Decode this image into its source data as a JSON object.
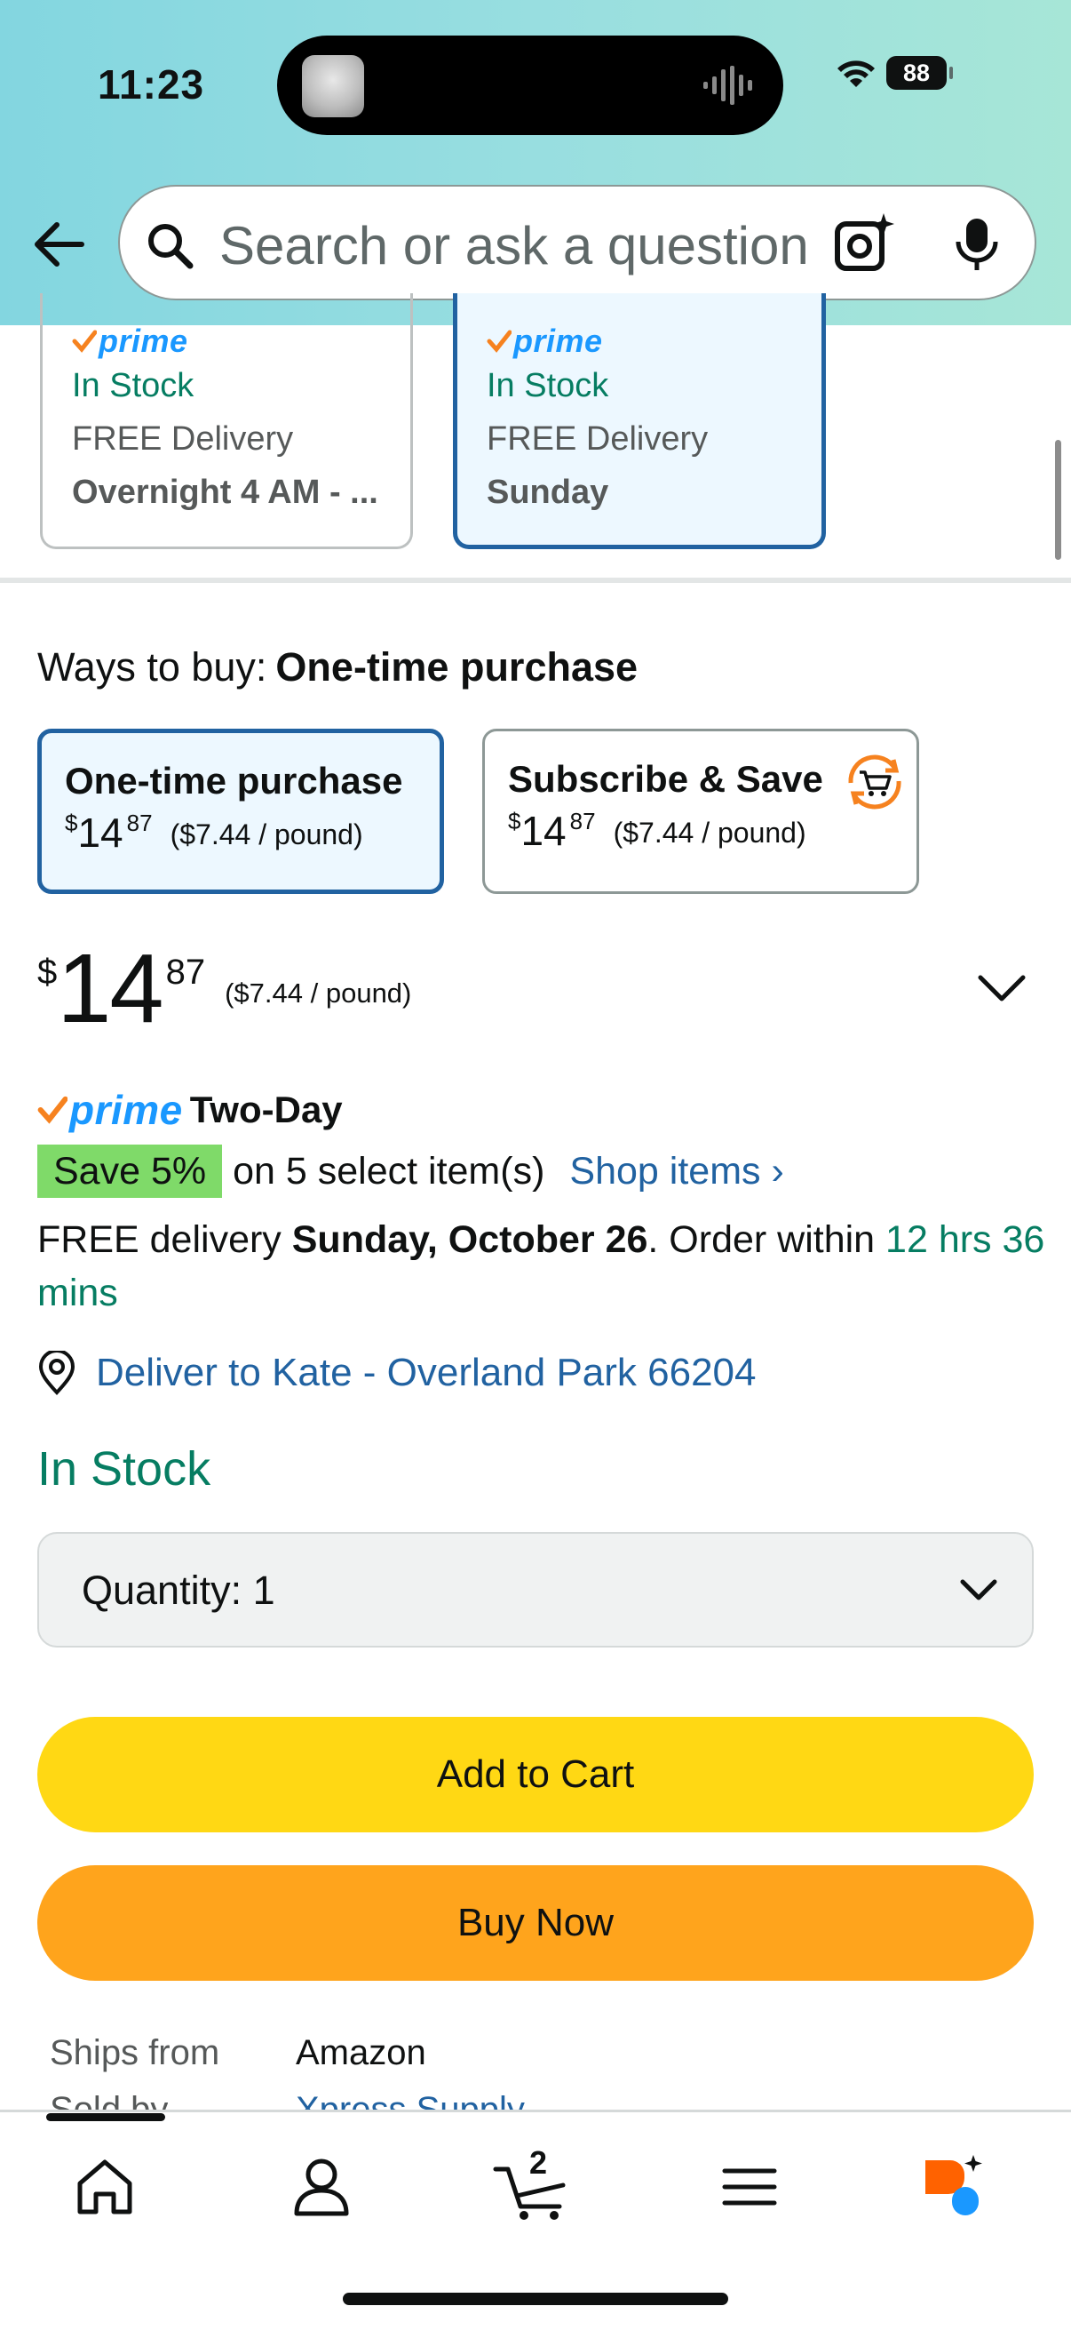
{
  "status_bar": {
    "time": "11:23",
    "battery": "88"
  },
  "search": {
    "placeholder": "Search or ask a question"
  },
  "delivery_options": [
    {
      "prime": "prime",
      "stock": "In Stock",
      "delivery": "FREE Delivery",
      "date": "Overnight 4 AM - ...",
      "selected": false
    },
    {
      "prime": "prime",
      "stock": "In Stock",
      "delivery": "FREE Delivery",
      "date": "Sunday",
      "selected": true
    }
  ],
  "ways_to_buy": {
    "label": "Ways to buy:",
    "selected": "One-time purchase",
    "options": [
      {
        "title": "One-time purchase",
        "currency": "$",
        "dollars": "14",
        "cents": "87",
        "unit_price": "($7.44 / pound)"
      },
      {
        "title": "Subscribe & Save",
        "currency": "$",
        "dollars": "14",
        "cents": "87",
        "unit_price": "($7.44 / pound)"
      }
    ]
  },
  "price": {
    "currency": "$",
    "dollars": "14",
    "cents": "87",
    "unit_price": "($7.44 / pound)"
  },
  "prime_badge": {
    "word": "prime",
    "label": "Two-Day"
  },
  "promo": {
    "badge": "Save 5%",
    "text": "on 5 select item(s)",
    "link": "Shop items ›"
  },
  "delivery": {
    "prefix": "FREE delivery ",
    "date": "Sunday, October 26",
    "middle": ". Order within ",
    "countdown": "12 hrs 36 mins"
  },
  "deliver_to": "Deliver to Kate - Overland Park 66204",
  "stock_status": "In Stock",
  "quantity": {
    "label": "Quantity: 1"
  },
  "buttons": {
    "add_to_cart": "Add to Cart",
    "buy_now": "Buy Now"
  },
  "ship_info": {
    "ships_from_label": "Ships from",
    "ships_from_value": "Amazon",
    "sold_by_label": "Sold by",
    "sold_by_value": "Xpress Supply"
  },
  "nav": {
    "cart_count": "2"
  },
  "colors": {
    "prime_blue": "#1a98ff",
    "link_blue": "#2162a1",
    "teal": "#067d62",
    "cart_yellow": "#ffd814",
    "buy_orange": "#ffa41c",
    "save_green": "#7fda69"
  },
  "icons": [
    "back-arrow-icon",
    "search-icon",
    "camera-lens-icon",
    "microphone-icon",
    "subscribe-cart-icon",
    "chevron-down-icon",
    "location-pin-icon",
    "home-icon",
    "account-icon",
    "cart-icon",
    "menu-icon",
    "rufus-icon",
    "wifi-icon",
    "battery-icon"
  ]
}
